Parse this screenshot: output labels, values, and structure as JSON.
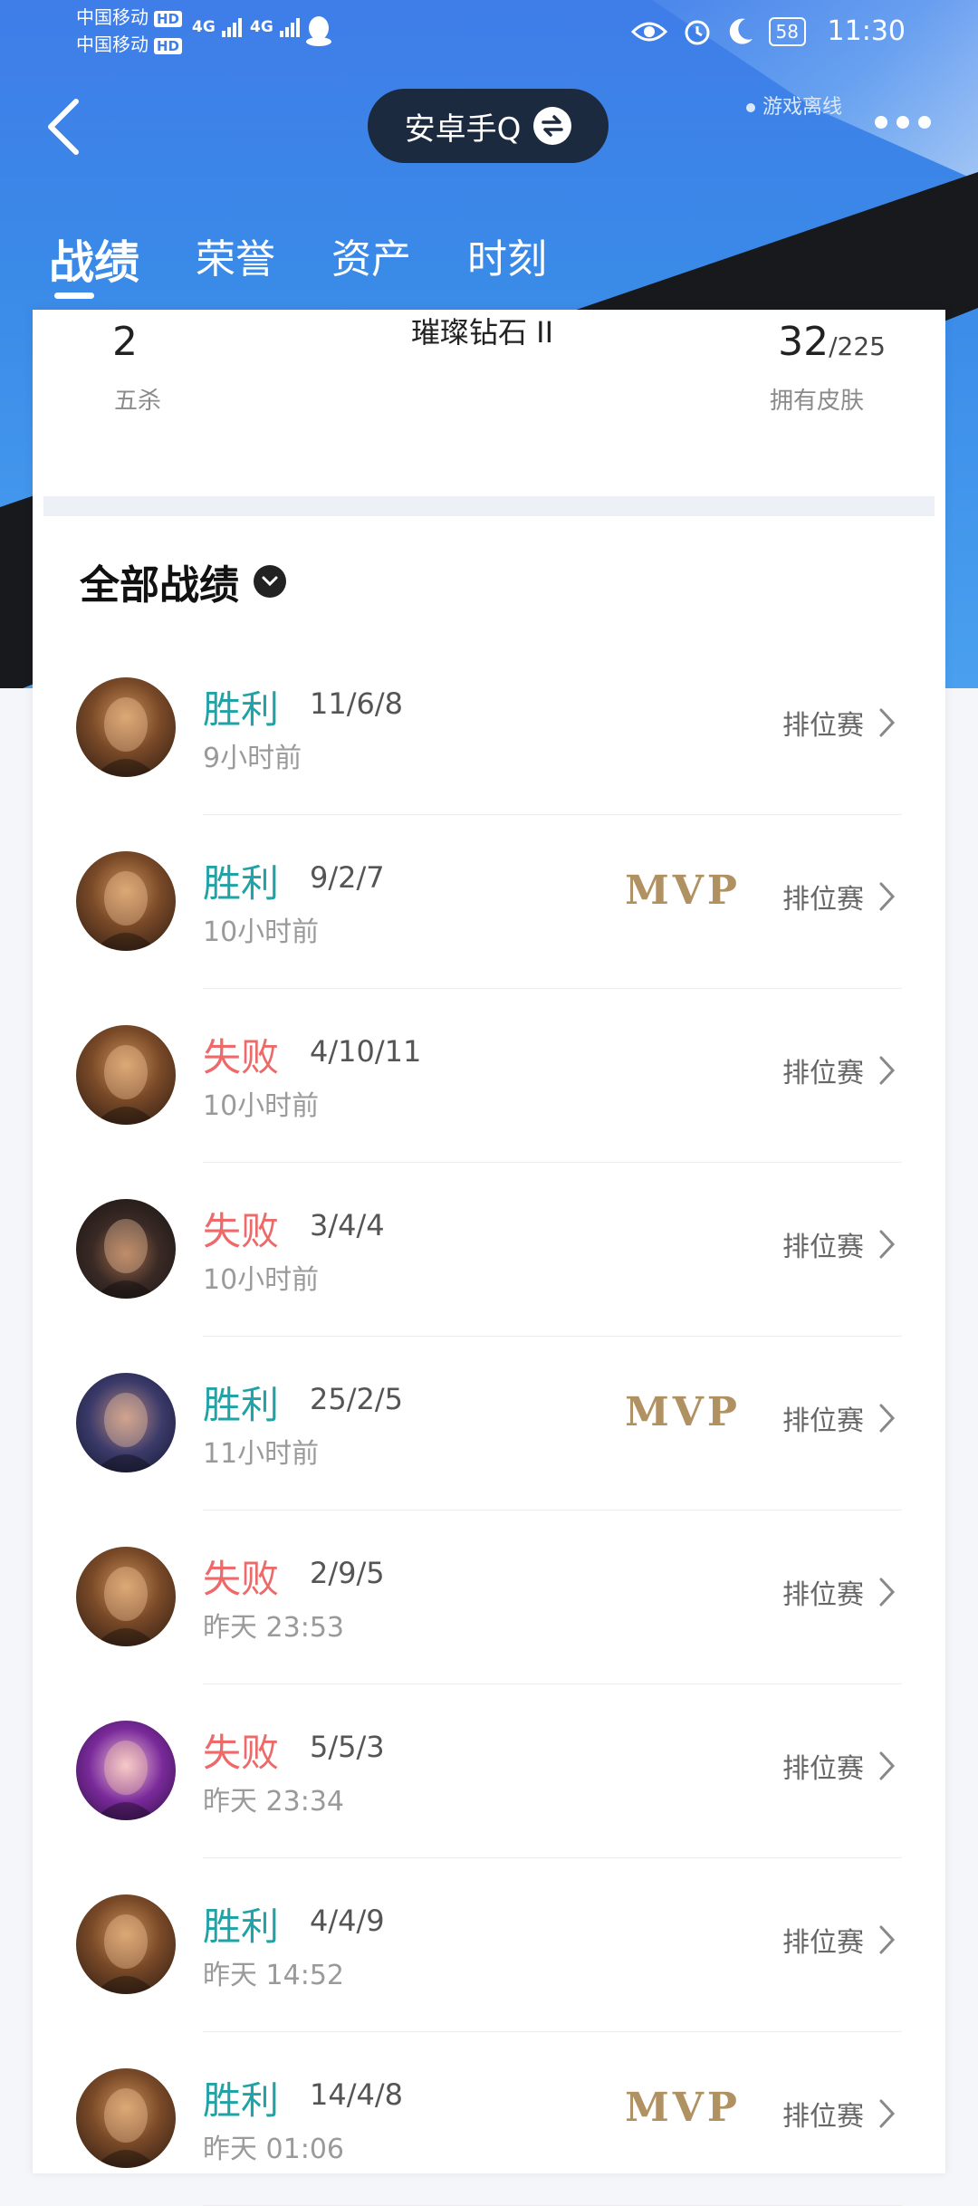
{
  "status_bar": {
    "carrier1": "中国移动",
    "carrier2": "中国移动",
    "hd": "HD",
    "net1": "4G",
    "net2": "4G",
    "battery": "58",
    "time": "11:30"
  },
  "header": {
    "title": "安卓手Q",
    "offline_status": "游戏离线"
  },
  "tabs": [
    "战绩",
    "荣誉",
    "资产",
    "时刻"
  ],
  "stats": {
    "pentakills_value": "2",
    "pentakills_label": "五杀",
    "rank": "璀璨钻石 II",
    "skins_owned": "32",
    "skins_total": "/225",
    "skins_label": "拥有皮肤"
  },
  "section": {
    "title": "全部战绩"
  },
  "matches": [
    {
      "result": "胜利",
      "kda": "11/6/8",
      "time": "9小时前",
      "mvp": "",
      "mode": "排位赛"
    },
    {
      "result": "胜利",
      "kda": "9/2/7",
      "time": "10小时前",
      "mvp": "MVP",
      "mode": "排位赛"
    },
    {
      "result": "失败",
      "kda": "4/10/11",
      "time": "10小时前",
      "mvp": "",
      "mode": "排位赛"
    },
    {
      "result": "失败",
      "kda": "3/4/4",
      "time": "10小时前",
      "mvp": "",
      "mode": "排位赛"
    },
    {
      "result": "胜利",
      "kda": "25/2/5",
      "time": "11小时前",
      "mvp": "MVP",
      "mode": "排位赛"
    },
    {
      "result": "失败",
      "kda": "2/9/5",
      "time": "昨天 23:53",
      "mvp": "",
      "mode": "排位赛"
    },
    {
      "result": "失败",
      "kda": "5/5/3",
      "time": "昨天 23:34",
      "mvp": "",
      "mode": "排位赛"
    },
    {
      "result": "胜利",
      "kda": "4/4/9",
      "time": "昨天 14:52",
      "mvp": "",
      "mode": "排位赛"
    },
    {
      "result": "胜利",
      "kda": "14/4/8",
      "time": "昨天 01:06",
      "mvp": "MVP",
      "mode": "排位赛"
    }
  ],
  "colors": {
    "win": "#1fa3a6",
    "lose": "#ec6a6a",
    "mvp": "#b09262",
    "header_blue": "#3f7de8"
  }
}
